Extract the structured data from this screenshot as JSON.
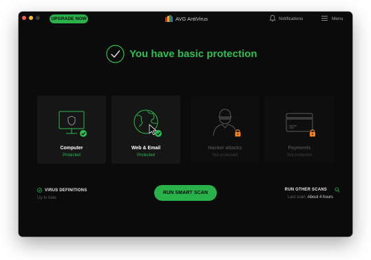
{
  "titlebar": {
    "upgrade_label": "UPGRADE NOW",
    "app_title": "AVG AntiVirus",
    "notifications_label": "Notifications",
    "menu_label": "Menu"
  },
  "status": {
    "title": "You have basic protection"
  },
  "cards": [
    {
      "title": "Computer",
      "status": "Protected",
      "icon": "monitor-shield-icon",
      "state": "protected"
    },
    {
      "title": "Web & Email",
      "status": "Protected",
      "icon": "globe-cursor-icon",
      "state": "protected"
    },
    {
      "title": "Hacker attacks",
      "status": "Not protected",
      "icon": "hacker-icon",
      "state": "locked"
    },
    {
      "title": "Payments",
      "status": "Not protected",
      "icon": "credit-card-icon",
      "state": "locked"
    }
  ],
  "bottom": {
    "virus_definitions_label": "VIRUS DEFINITIONS",
    "virus_definitions_status": "Up to date",
    "scan_button_label": "RUN SMART SCAN",
    "other_scans_label": "RUN OTHER SCANS",
    "last_scan_label": "Last scan:",
    "last_scan_value": "About 4 hours"
  },
  "colors": {
    "accent_green": "#29b14a",
    "status_green": "#2dbf52",
    "lock_orange": "#f5821f",
    "window_bg": "#0b0b0b"
  }
}
